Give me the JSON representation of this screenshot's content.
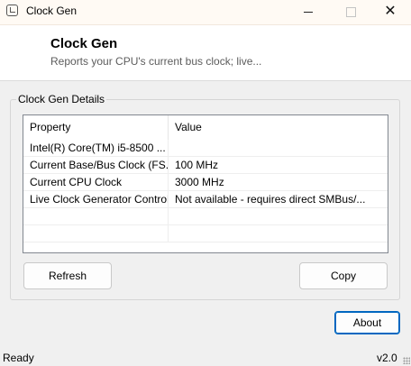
{
  "window": {
    "title": "Clock Gen",
    "close_glyph": "✕"
  },
  "header": {
    "title": "Clock Gen",
    "subtitle": "Reports your CPU's current bus clock; live..."
  },
  "group": {
    "label": "Clock Gen Details"
  },
  "table": {
    "columns": [
      "Property",
      "Value"
    ],
    "rows": [
      {
        "property": "Intel(R) Core(TM) i5-8500 ...",
        "value": ""
      },
      {
        "property": "Current Base/Bus Clock (FS...",
        "value": "100 MHz"
      },
      {
        "property": "Current CPU Clock",
        "value": "3000 MHz"
      },
      {
        "property": "Live Clock Generator Control",
        "value": "Not available - requires direct SMBus/..."
      }
    ]
  },
  "buttons": {
    "refresh": "Refresh",
    "copy": "Copy",
    "about": "About"
  },
  "status": {
    "text": "Ready",
    "version": "v2.0"
  },
  "colors": {
    "accent": "#0067c0"
  }
}
